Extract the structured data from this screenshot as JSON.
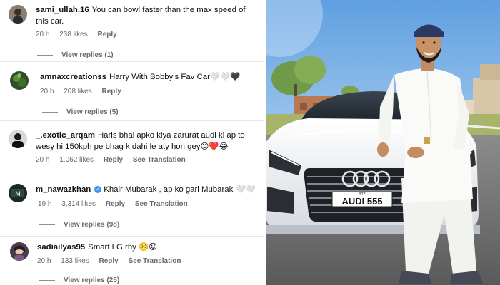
{
  "comments": [
    {
      "username": "sami_ullah.16",
      "text": "You can bowl faster than the max speed of this car.",
      "time": "20 h",
      "likes": "238 likes",
      "reply": "Reply",
      "view_replies": "View replies (1)"
    },
    {
      "username": "amnaxcreationss",
      "text": "Harry With Bobby's Fav Car🤍🤍🖤",
      "time": "20 h",
      "likes": "208 likes",
      "reply": "Reply",
      "view_replies": "View replies (5)"
    },
    {
      "username": "_.exotic_arqam",
      "text": "Haris bhai apko kiya zarurat audi ki ap to wesy hi 150kph pe bhag k dahi le aty hon gey😊❤️😂",
      "time": "20 h",
      "likes": "1,062 likes",
      "reply": "Reply",
      "translate": "See Translation"
    },
    {
      "username": "m_nawazkhan",
      "verified": true,
      "text": "Khair Mubarak , ap ko gari Mubarak 🤍🤍",
      "time": "19 h",
      "likes": "3,314 likes",
      "reply": "Reply",
      "translate": "See Translation",
      "view_replies": "View replies (98)"
    },
    {
      "username": "sadiailyas95",
      "text": "Smart LG rhy 🥺😟",
      "time": "20 h",
      "likes": "133 likes",
      "reply": "Reply",
      "translate": "See Translation",
      "view_replies": "View replies (25)"
    }
  ],
  "photo": {
    "plate": "AUDI 555",
    "plate_tag": "BTZ",
    "colors": {
      "sky": "#7fb3e8",
      "car": "#eef1f4",
      "outfit": "#f6f6f4",
      "cap": "#2a3a63"
    }
  }
}
